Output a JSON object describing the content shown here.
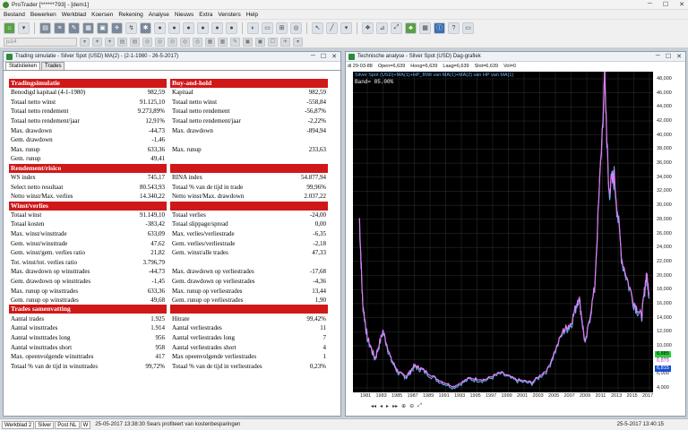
{
  "app": {
    "title": "ProTrader [******793] - [dem1]"
  },
  "menu": [
    "Bestand",
    "Bewerken",
    "Werkblad",
    "Koersen",
    "Rekening",
    "Analyse",
    "Nieuws",
    "Extra",
    "Vensters",
    "Help"
  ],
  "symbol_field": {
    "value": "ju14"
  },
  "sim": {
    "title": "Trading simulatie - Silver Spot (USD) MA(2) - (2-1-1980 - 26-5-2017)",
    "tabs": [
      "Statistieken",
      "Trades"
    ],
    "left": [
      {
        "header": "Tradingsimulatie",
        "rows": [
          [
            "Benodigd kapitaal (4-1-1980)",
            "982,59"
          ],
          [
            "Totaal netto winst",
            "91.125,10"
          ],
          [
            "Totaal netto rendement",
            "9.273,89%"
          ],
          [
            "Totaal netto rendement/jaar",
            "12,91%"
          ],
          [
            "Max. drawdown",
            "-44,73"
          ],
          [
            "Gem. drawdown",
            "-1,46"
          ],
          [
            "Max. runup",
            "633,36"
          ],
          [
            "Gem. runup",
            "49,41"
          ]
        ]
      },
      {
        "header": "Rendement/risico",
        "rows": [
          [
            "WS index",
            "745,17"
          ],
          [
            "Select netto resultaat",
            "80.543,93"
          ],
          [
            "Netto winst/Max. verlies",
            "14.340,22"
          ]
        ]
      },
      {
        "header": "Winst/verlies",
        "rows": [
          [
            "Totaal winst",
            "91.149,10"
          ],
          [
            "Totaal kosten",
            "-383,42"
          ],
          [
            "Max. winst/winsttrade",
            "633,09"
          ],
          [
            "Gem. winst/winsttrade",
            "47,62"
          ],
          [
            "Gem. winst/gem. verlies ratio",
            "21,82"
          ],
          [
            "Tot. winst/tot. verlies ratio",
            "3.796,79"
          ],
          [
            "Max. drawdown op winsttrades",
            "-44,73"
          ],
          [
            "Gem. drawdown op winsttrades",
            "-1,45"
          ],
          [
            "Max. runup op winsttrades",
            "633,36"
          ],
          [
            "Gem. runup op winsttrades",
            "49,68"
          ]
        ]
      },
      {
        "header": "Trades samenvatting",
        "rows": [
          [
            "Aantal trades",
            "1.925"
          ],
          [
            "Aantal winsttrades",
            "1.914"
          ],
          [
            "Aantal winsttrades long",
            "956"
          ],
          [
            "Aantal winsttrades short",
            "958"
          ],
          [
            "Max. opeenvolgende winsttrades",
            "417"
          ],
          [
            "Totaal % van de tijd in winsttrades",
            "99,72%"
          ]
        ]
      }
    ],
    "right": [
      {
        "header": "Buy-and-hold",
        "rows": [
          [
            "Kapitaal",
            "982,59"
          ],
          [
            "Totaal netto winst",
            "-558,84"
          ],
          [
            "Totaal netto rendement",
            "-56,87%"
          ],
          [
            "Totaal netto rendement/jaar",
            "-2,22%"
          ],
          [
            "Max. drawdown",
            "-894,94"
          ],
          [
            "",
            ""
          ],
          [
            "Max. runup",
            "233,63"
          ],
          [
            "",
            ""
          ]
        ]
      },
      {
        "header": "",
        "rows": [
          [
            "RINA index",
            "54.877,94"
          ],
          [
            "Totaal % van de tijd in trade",
            "99,96%"
          ],
          [
            "Netto winst/Max. drawdown",
            "2.037,22"
          ]
        ]
      },
      {
        "header": "",
        "rows": [
          [
            "Totaal verlies",
            "-24,00"
          ],
          [
            "Totaal slippage/spread",
            "0,00"
          ],
          [
            "Max. verlies/verliestrade",
            "-6,35"
          ],
          [
            "Gem. verlies/verliestrade",
            "-2,18"
          ],
          [
            "Gem. winst/alle trades",
            "47,33"
          ],
          [
            "",
            ""
          ],
          [
            "Max. drawdown op verliestrades",
            "-17,68"
          ],
          [
            "Gem. drawdown op verliestrades",
            "-4,36"
          ],
          [
            "Max. runup op verliestrades",
            "13,44"
          ],
          [
            "Gem. runup op verliestrades",
            "1,90"
          ]
        ]
      },
      {
        "header": "",
        "rows": [
          [
            "Hitrate",
            "99,42%"
          ],
          [
            "Aantal verliestrades",
            "11"
          ],
          [
            "Aantal verliestrades long",
            "7"
          ],
          [
            "Aantal verliestrades short",
            "4"
          ],
          [
            "Max opeenvolgende verliestrades",
            "1"
          ],
          [
            "Totaal % van de tijd in verliestrades",
            "0,23%"
          ]
        ]
      }
    ]
  },
  "tech": {
    "title": "Technische analyse - Silver Spot (USD) Dag-grafiek",
    "ohlc": [
      "di 29-03-88",
      "Open=6,639",
      "Hoog=6,639",
      "Laag=6,639",
      "Slot=6,639",
      "Vol=0"
    ],
    "legend": "Silver Spot (USD)+MA(1)+HP_BWt van MA(1)+MA(2) van HP van MA(1)",
    "band": "Band= 85.00%",
    "yticks": [
      "48,000",
      "46,000",
      "44,000",
      "42,000",
      "40,000",
      "38,000",
      "36,000",
      "34,000",
      "32,000",
      "30,000",
      "28,000",
      "26,000",
      "24,000",
      "22,000",
      "20,000",
      "18,000",
      "16,000",
      "14,000",
      "12,000",
      "10,000",
      "8,000",
      "6,000",
      "4,000"
    ],
    "xticks": [
      "1981",
      "1983",
      "1985",
      "1987",
      "1989",
      "1991",
      "1993",
      "1995",
      "1997",
      "1999",
      "2001",
      "2003",
      "2005",
      "2007",
      "2009",
      "2011",
      "2013",
      "2015",
      "2017"
    ],
    "price_labels": [
      {
        "text": "6,885",
        "bg": "#2ecc40",
        "fg": "#000"
      },
      {
        "text": "6,879",
        "bg": "#ffffff",
        "fg": "#c43bd6"
      },
      {
        "text": "6,815",
        "bg": "#1a4fd0",
        "fg": "#fff"
      }
    ],
    "series_colors": {
      "price": "#6ab7ff",
      "ma": "#e27bf0"
    }
  },
  "status": {
    "tabs": [
      "Werkblad 2",
      "Silver",
      "Post NL",
      "W"
    ],
    "news": "25-05-2017 13:38:30 Sears profiteert van kostenbesparingen",
    "time": "25-5-2017 13:40:15"
  }
}
